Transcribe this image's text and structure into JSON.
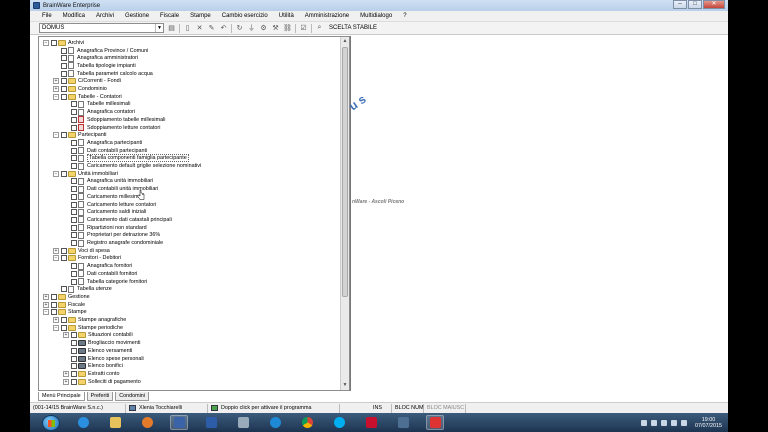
{
  "window": {
    "title": "BrainWare Enterprise",
    "buttons": {
      "minimize": "–",
      "maximize": "□",
      "close": "✕"
    }
  },
  "menu": [
    "File",
    "Modifica",
    "Archivi",
    "Gestione",
    "Fiscale",
    "Stampe",
    "Cambio esercizio",
    "Utilità",
    "Amministrazione",
    "Multidialogo",
    "?"
  ],
  "toolbar": {
    "combo_value": "DOMUS",
    "scelta_label": "SCELTA STABILE"
  },
  "tree": [
    {
      "depth": 0,
      "exp": "−",
      "icon": "folder",
      "label": "Archivi"
    },
    {
      "depth": 1,
      "exp": "",
      "icon": "doc",
      "label": "Anagrafica Province / Comuni"
    },
    {
      "depth": 1,
      "exp": "",
      "icon": "doc",
      "label": "Anagrafica amministratori"
    },
    {
      "depth": 1,
      "exp": "",
      "icon": "doc",
      "label": "Tabella tipologie impianti"
    },
    {
      "depth": 1,
      "exp": "",
      "icon": "doc",
      "label": "Tabella parametri calcolo acqua"
    },
    {
      "depth": 1,
      "exp": "+",
      "icon": "folder",
      "label": "C/Correnti - Fondi"
    },
    {
      "depth": 1,
      "exp": "+",
      "icon": "folder",
      "label": "Condominio"
    },
    {
      "depth": 1,
      "exp": "−",
      "icon": "folder",
      "label": "Tabelle - Contatori"
    },
    {
      "depth": 2,
      "exp": "",
      "icon": "doc",
      "label": "Tabelle millesimali"
    },
    {
      "depth": 2,
      "exp": "",
      "icon": "doc",
      "label": "Anagrafica contatori"
    },
    {
      "depth": 2,
      "exp": "",
      "icon": "red",
      "label": "Sdoppiamento tabelle millesimali"
    },
    {
      "depth": 2,
      "exp": "",
      "icon": "red",
      "label": "Sdoppiamento letture contatori"
    },
    {
      "depth": 1,
      "exp": "−",
      "icon": "folder",
      "label": "Partecipanti"
    },
    {
      "depth": 2,
      "exp": "",
      "icon": "doc",
      "label": "Anagrafica partecipanti"
    },
    {
      "depth": 2,
      "exp": "",
      "icon": "doc",
      "label": "Dati contabili partecipanti"
    },
    {
      "depth": 2,
      "exp": "",
      "icon": "doc",
      "label": "Tabella componenti famiglia partecipante",
      "highlight": true
    },
    {
      "depth": 2,
      "exp": "",
      "icon": "doc",
      "label": "Caricamento default griglie selezione nominativi"
    },
    {
      "depth": 1,
      "exp": "−",
      "icon": "folder",
      "label": "Unità immobiliari"
    },
    {
      "depth": 2,
      "exp": "",
      "icon": "doc",
      "label": "Anagrafica unità immobiliari"
    },
    {
      "depth": 2,
      "exp": "",
      "icon": "doc",
      "label": "Dati contabili unità immobiliari"
    },
    {
      "depth": 2,
      "exp": "",
      "icon": "doc",
      "label": "Caricamento millesimi"
    },
    {
      "depth": 2,
      "exp": "",
      "icon": "doc",
      "label": "Caricamento letture contatori"
    },
    {
      "depth": 2,
      "exp": "",
      "icon": "doc",
      "label": "Caricamento saldi iniziali"
    },
    {
      "depth": 2,
      "exp": "",
      "icon": "doc",
      "label": "Caricamento dati catastali principali"
    },
    {
      "depth": 2,
      "exp": "",
      "icon": "doc",
      "label": "Ripartizioni non standard"
    },
    {
      "depth": 2,
      "exp": "",
      "icon": "doc",
      "label": "Proprietari per detrazione 36%"
    },
    {
      "depth": 2,
      "exp": "",
      "icon": "doc",
      "label": "Registro anagrafe condominiale"
    },
    {
      "depth": 1,
      "exp": "+",
      "icon": "folder",
      "label": "Voci di spesa"
    },
    {
      "depth": 1,
      "exp": "−",
      "icon": "folder",
      "label": "Fornitori - Debitori"
    },
    {
      "depth": 2,
      "exp": "",
      "icon": "doc",
      "label": "Anagrafica fornitori"
    },
    {
      "depth": 2,
      "exp": "",
      "icon": "doc",
      "label": "Dati contabili fornitori"
    },
    {
      "depth": 2,
      "exp": "",
      "icon": "doc",
      "label": "Tabella categorie fornitori"
    },
    {
      "depth": 1,
      "exp": "",
      "icon": "doc",
      "label": "Tabella utenze"
    },
    {
      "depth": 0,
      "exp": "+",
      "icon": "folder",
      "label": "Gestione"
    },
    {
      "depth": 0,
      "exp": "+",
      "icon": "folder",
      "label": "Fiscale"
    },
    {
      "depth": 0,
      "exp": "−",
      "icon": "folder",
      "label": "Stampe"
    },
    {
      "depth": 1,
      "exp": "+",
      "icon": "folder",
      "label": "Stampe anagrafiche"
    },
    {
      "depth": 1,
      "exp": "−",
      "icon": "folder",
      "label": "Stampe periodiche"
    },
    {
      "depth": 2,
      "exp": "+",
      "icon": "folder",
      "label": "Situazioni contabili"
    },
    {
      "depth": 2,
      "exp": "",
      "icon": "print",
      "label": "Brogliaccio movimenti"
    },
    {
      "depth": 2,
      "exp": "",
      "icon": "print",
      "label": "Elenco versamenti"
    },
    {
      "depth": 2,
      "exp": "",
      "icon": "print",
      "label": "Elenco spese personali"
    },
    {
      "depth": 2,
      "exp": "",
      "icon": "print",
      "label": "Elenco bonifici"
    },
    {
      "depth": 2,
      "exp": "+",
      "icon": "folder",
      "label": "Estratti conto"
    },
    {
      "depth": 2,
      "exp": "+",
      "icon": "folder",
      "label": "Solleciti di pagamento"
    }
  ],
  "right_caption": "nWare - Ascoli Piceno",
  "tabs": [
    "Menù Principale",
    "Preferiti",
    "Condomini"
  ],
  "status": {
    "company": "(001-14/15 BrainWare S.n.c.)",
    "user": "Xlenia Tocchiarelli",
    "hint": "Doppio click per attivare il programma",
    "ins": "INS",
    "num": "BLOC NUM",
    "caps": "BLOC MAIUSC"
  },
  "clock": {
    "time": "19:00",
    "date": "07/07/2015"
  },
  "colors": {
    "taskbar": "#1d3451",
    "folder": "#f3d36a",
    "accent": "#2d5a9a"
  }
}
